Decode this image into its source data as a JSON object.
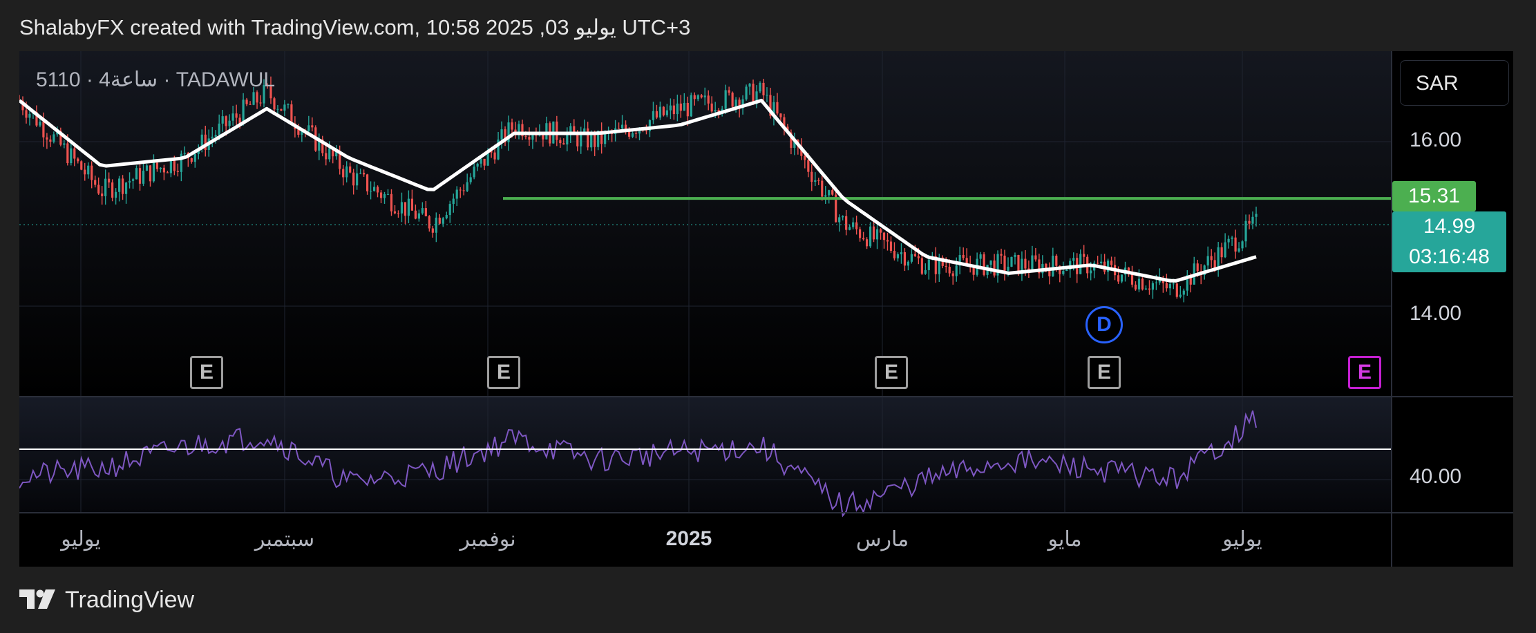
{
  "header": {
    "title": "ShalabyFX created with TradingView.com, يوليو 03, 2025 10:58 UTC+3"
  },
  "symbol": {
    "label": "5110 · 4ساعة · TADAWUL"
  },
  "currency": "SAR",
  "price_axis": {
    "ticks": [
      "16.00",
      "14.00"
    ]
  },
  "level_badge": "15.31",
  "last_price": {
    "value": "14.99",
    "countdown": "03:16:48"
  },
  "rsi_axis": {
    "ticks": [
      "40.00"
    ]
  },
  "x_axis": {
    "labels": [
      "يوليو",
      "سبتمبر",
      "نوفمبر",
      "2025",
      "مارس",
      "مايو",
      "يوليو"
    ]
  },
  "events": {
    "earnings_label": "E",
    "dividend_label": "D"
  },
  "footer": {
    "brand": "TradingView"
  },
  "colors": {
    "up": "#26a69a",
    "down": "#ef5350",
    "ma": "#ffffff",
    "level": "#4caf50",
    "rsi": "#7e57c2",
    "grid": "#1f2430",
    "future_event": "#c41fd1",
    "dividend": "#2962ff"
  },
  "chart_data": {
    "type": "candlestick",
    "title": "",
    "instrument": "5110 · 4ساعة · TADAWUL",
    "currency": "SAR",
    "x": [
      "2024-06",
      "2024-07",
      "2024-08",
      "2024-09",
      "2024-10",
      "2024-11",
      "2024-12",
      "2025-01",
      "2025-02",
      "2025-03",
      "2025-03-20",
      "2025-04",
      "2025-05",
      "2025-06",
      "2025-06-20",
      "2025-07-03"
    ],
    "series": [
      {
        "name": "",
        "kind": "close",
        "values": [
          16.5,
          15.4,
          15.8,
          16.6,
          15.6,
          15.0,
          16.2,
          16.0,
          16.4,
          16.6,
          15.0,
          14.5,
          14.5,
          14.5,
          14.2,
          15.0
        ]
      },
      {
        "name": "",
        "kind": "moving_average",
        "values": [
          16.5,
          15.7,
          15.8,
          16.4,
          15.8,
          15.4,
          16.1,
          16.1,
          16.2,
          16.5,
          15.3,
          14.6,
          14.4,
          14.5,
          14.3,
          14.6
        ]
      },
      {
        "name": "",
        "kind": "rsi",
        "values": [
          41,
          44,
          52,
          56,
          39,
          43,
          55,
          47,
          50,
          52,
          30,
          40,
          47,
          44,
          40,
          62
        ]
      }
    ],
    "horizontal_level": 15.31,
    "last_price": 14.99,
    "y_ticks": [
      16.0,
      14.0
    ],
    "ylim": [
      12.9,
      17.1
    ],
    "rsi_ticks": [
      40.0
    ],
    "rsi_reference": 51,
    "x_tick_labels": [
      "يوليو",
      "سبتمبر",
      "نوفمبر",
      "2025",
      "مارس",
      "مايو",
      "يوليو"
    ],
    "events": [
      "E",
      "E",
      "E",
      "D",
      "E",
      "E"
    ],
    "grid": true,
    "legend": "none"
  }
}
